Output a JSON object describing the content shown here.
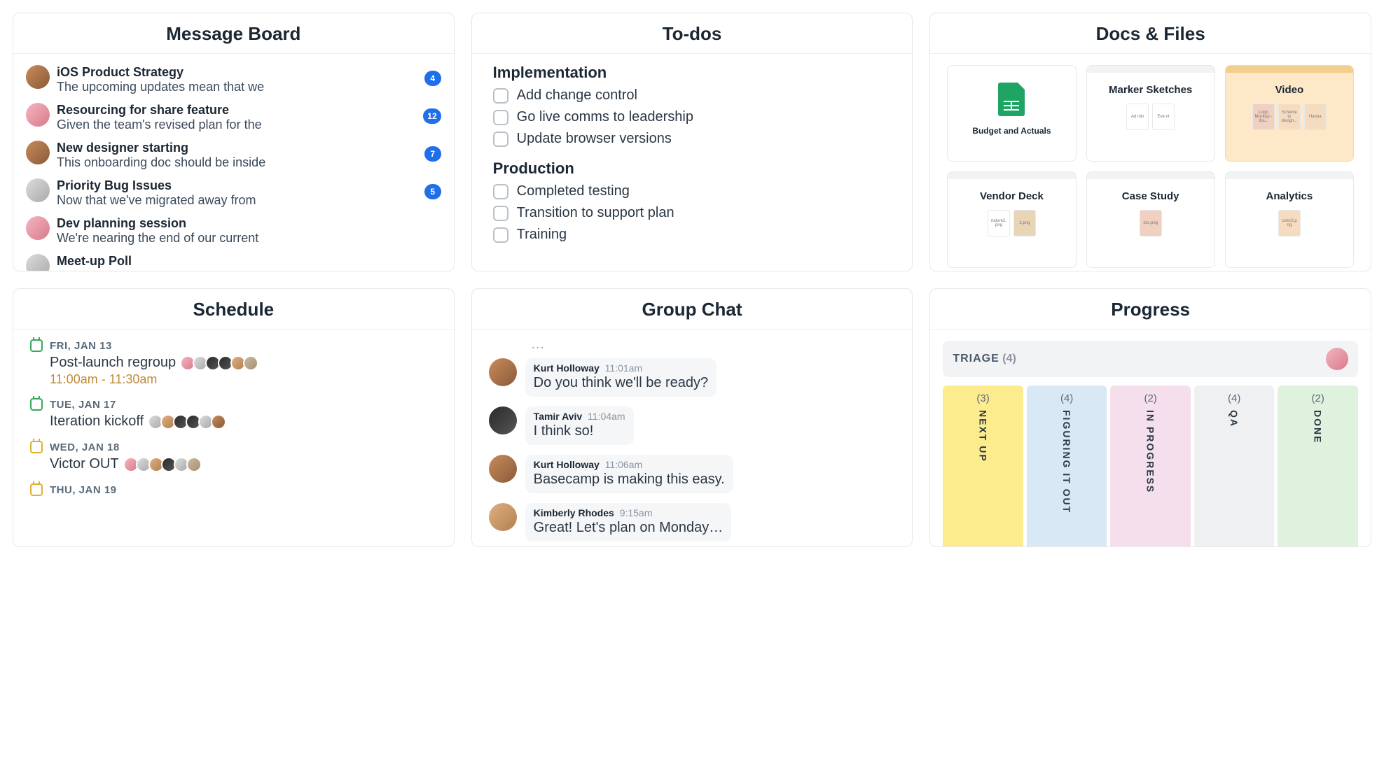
{
  "message_board": {
    "title": "Message Board",
    "items": [
      {
        "title": "iOS Product Strategy",
        "preview": "The upcoming updates mean that we",
        "badge": "4"
      },
      {
        "title": "Resourcing for share feature",
        "preview": "Given the team's revised plan for the",
        "badge": "12"
      },
      {
        "title": "New designer starting",
        "preview": "This onboarding doc should be inside",
        "badge": "7"
      },
      {
        "title": "Priority Bug Issues",
        "preview": "Now that we've migrated away from",
        "badge": "5"
      },
      {
        "title": "Dev planning session",
        "preview": "We're nearing the end of our current",
        "badge": ""
      },
      {
        "title": "Meet-up Poll",
        "preview": "",
        "badge": ""
      }
    ]
  },
  "todos": {
    "title": "To-dos",
    "groups": [
      {
        "name": "Implementation",
        "items": [
          "Add change control",
          "Go live comms to leadership",
          "Update browser versions"
        ]
      },
      {
        "name": "Production",
        "items": [
          "Completed testing",
          "Transition to support plan",
          "Training"
        ]
      }
    ]
  },
  "docs": {
    "title": "Docs & Files",
    "tiles": [
      {
        "name": "Budget and Actuals",
        "type": "sheet"
      },
      {
        "name": "Marker Sketches",
        "type": "folder",
        "thumbs": [
          "Ad min",
          "Eve nt"
        ]
      },
      {
        "name": "Video",
        "type": "folder",
        "highlight": true,
        "thumbs": [
          "Logo Mockup - dra...",
          "Scheme to design...",
          "Hanna"
        ]
      },
      {
        "name": "Vendor Deck",
        "type": "folder",
        "thumbs": [
          "nature2. png",
          "2.png"
        ]
      },
      {
        "name": "Case Study",
        "type": "folder",
        "thumbs": [
          "cks.png"
        ]
      },
      {
        "name": "Analytics",
        "type": "folder",
        "thumbs": [
          "color2.p ng"
        ]
      }
    ]
  },
  "schedule": {
    "title": "Schedule",
    "days": [
      {
        "date": "FRI, JAN 13",
        "events": [
          {
            "title": "Post-launch regroup",
            "time": "11:00am - 11:30am",
            "avatars": 6
          }
        ],
        "color": "green"
      },
      {
        "date": "TUE, JAN 17",
        "events": [
          {
            "title": "Iteration kickoff",
            "time": "",
            "avatars": 6
          }
        ],
        "color": "green"
      },
      {
        "date": "WED, JAN 18",
        "events": [
          {
            "title": "Victor OUT",
            "time": "",
            "avatars": 6
          }
        ],
        "color": "yellow"
      },
      {
        "date": "THU, JAN 19",
        "events": [],
        "color": "yellow"
      }
    ]
  },
  "chat": {
    "title": "Group Chat",
    "ellipsis": "…",
    "messages": [
      {
        "author": "Kurt Holloway",
        "time": "11:01am",
        "text": "Do you think we'll be ready?"
      },
      {
        "author": "Tamir Aviv",
        "time": "11:04am",
        "text": "I think so!"
      },
      {
        "author": "Kurt Holloway",
        "time": "11:06am",
        "text": "Basecamp is making this easy."
      },
      {
        "author": "Kimberly Rhodes",
        "time": "9:15am",
        "text": "Great! Let's plan on Monday…"
      }
    ]
  },
  "progress": {
    "title": "Progress",
    "triage": {
      "label": "TRIAGE",
      "count": "(4)"
    },
    "lanes": [
      {
        "name": "NEXT UP",
        "count": "(3)",
        "color": "yellow"
      },
      {
        "name": "FIGURING IT OUT",
        "count": "(4)",
        "color": "blue"
      },
      {
        "name": "IN PROGRESS",
        "count": "(2)",
        "color": "pink"
      },
      {
        "name": "QA",
        "count": "(4)",
        "color": "gray"
      },
      {
        "name": "DONE",
        "count": "(2)",
        "color": "green"
      }
    ]
  }
}
